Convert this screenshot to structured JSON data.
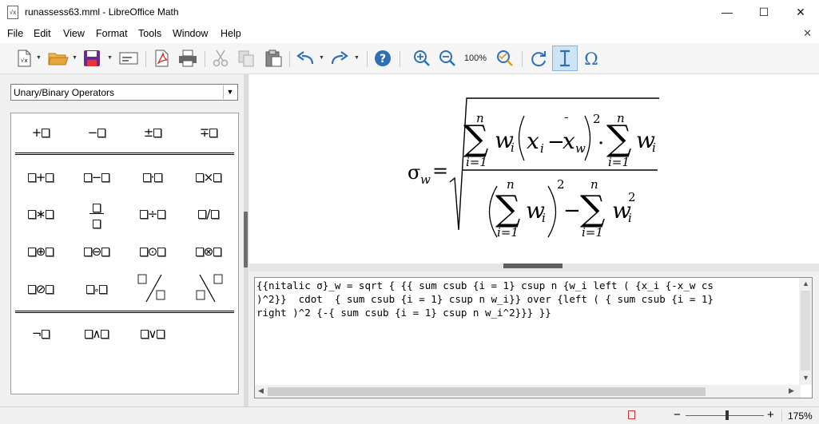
{
  "window": {
    "title": "runassess63.mml - LibreOffice Math",
    "minimize": "—",
    "maximize": "☐",
    "close": "✕"
  },
  "menu": {
    "items": [
      "File",
      "Edit",
      "View",
      "Format",
      "Tools",
      "Window",
      "Help"
    ],
    "close_doc": "✕"
  },
  "toolbar": {
    "zoom_label": "100%",
    "icons": [
      "new-formula-icon",
      "open-folder-icon",
      "save-icon",
      "send-email-icon",
      "export-pdf-icon",
      "print-icon",
      "cut-icon",
      "copy-icon",
      "paste-icon",
      "undo-icon",
      "redo-icon",
      "help-icon",
      "zoom-in-icon",
      "zoom-out-icon",
      "zoom-fit-icon",
      "update-icon",
      "formula-cursor-icon",
      "symbols-icon"
    ]
  },
  "elements_panel": {
    "category": "Unary/Binary Operators",
    "rows": [
      [
        "+",
        "−",
        "±",
        "∓"
      ],
      [
        "+",
        "−",
        "·",
        "×"
      ],
      [
        "∗",
        "÷",
        "/"
      ],
      [
        "⊕",
        "⊖",
        "⊙",
        "⊗"
      ],
      [
        "⊘",
        "∘"
      ],
      [
        "¬",
        "∧",
        "∨"
      ]
    ]
  },
  "formula": {
    "sigma": "σ",
    "sub_w": "w",
    "equals": "=",
    "sum": "∑",
    "n": "n",
    "i_eq_1": "i=1",
    "w": "w",
    "i": "i",
    "x": "x",
    "minus": "−",
    "xbar_accent": "¯",
    "two": "2",
    "cdot": "·"
  },
  "editor": {
    "lines": [
      "{{nitalic σ}_w = sqrt { {{ sum csub {i = 1} csup n {w_i left ( {x_i {-x_w cs",
      ")^2}}  cdot  { sum csub {i = 1} csup n w_i}} over {left ( { sum csub {i = 1}",
      "right )^2 {-{ sum csub {i = 1} csup n w_i^2}}} }}"
    ]
  },
  "status": {
    "zoom_out": "−",
    "zoom_in": "+",
    "zoom_level": "175%"
  },
  "colors": {
    "accent_blue": "#2f6db5",
    "save_purple": "#6c2a8c",
    "folder_orange": "#e8a33a",
    "highlight": "#cfe3f7"
  }
}
